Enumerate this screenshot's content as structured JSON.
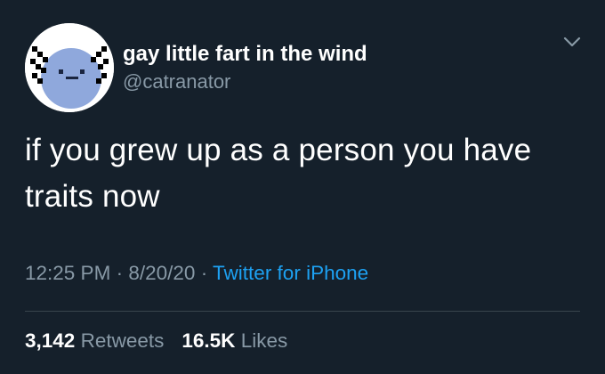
{
  "tweet": {
    "display_name": "gay little fart in the wind",
    "handle": "@catranator",
    "text": "if you grew up as a person you have traits now",
    "time": "12:25 PM",
    "separator": "·",
    "date": "8/20/20",
    "source": "Twitter for iPhone"
  },
  "stats": {
    "retweets_count": "3,142",
    "retweets_label": "Retweets",
    "likes_count": "16.5K",
    "likes_label": "Likes"
  },
  "icons": {
    "menu": "chevron-down-icon",
    "avatar": "axolotl-pixel-avatar"
  },
  "colors": {
    "background": "#15202b",
    "text": "#ffffff",
    "muted": "#8899a6",
    "link": "#1da1f2",
    "divider": "#38444d",
    "avatar_body": "#8fa8dc"
  }
}
